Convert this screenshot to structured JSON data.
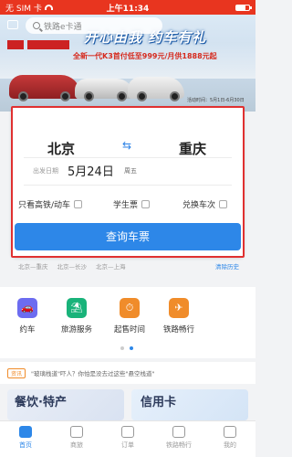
{
  "status_bar": {
    "carrier": "无 SIM 卡",
    "time": "上午11:34"
  },
  "search": {
    "placeholder": "铁路e卡通"
  },
  "banner": {
    "slogan": "开心由我 约车有礼",
    "offer": "全新一代K3首付低至999元/月供1888元起",
    "note": "活动时间：5月1日-6月30日"
  },
  "booking": {
    "from": "北京",
    "to": "重庆",
    "date_label": "出发日期",
    "date": "5月24日",
    "weekday": "周五",
    "options": [
      "只看高铁/动车",
      "学生票",
      "兑换车次"
    ],
    "query_button": "查询车票"
  },
  "history": {
    "items": [
      "北京—重庆",
      "北京—长沙",
      "北京—上海"
    ],
    "clear_label": "清除历史"
  },
  "services": [
    {
      "label": "约车",
      "icon": "car-icon",
      "color": "#6c6cf0"
    },
    {
      "label": "旅游服务",
      "icon": "travel-icon",
      "color": "#19b37a"
    },
    {
      "label": "起售时间",
      "icon": "clock-icon",
      "color": "#f08c2a"
    },
    {
      "label": "铁路畅行",
      "icon": "railway-icon",
      "color": "#f08c2a"
    }
  ],
  "promo": {
    "tag": "资讯",
    "text": "\"玻璃栈道\"吓人？你怕是没去过这些\"悬空栈道\""
  },
  "cards": {
    "food": "餐饮·特产",
    "credit": "信用卡"
  },
  "tabs": [
    "首页",
    "商旅",
    "订单",
    "铁路畅行",
    "我的"
  ]
}
